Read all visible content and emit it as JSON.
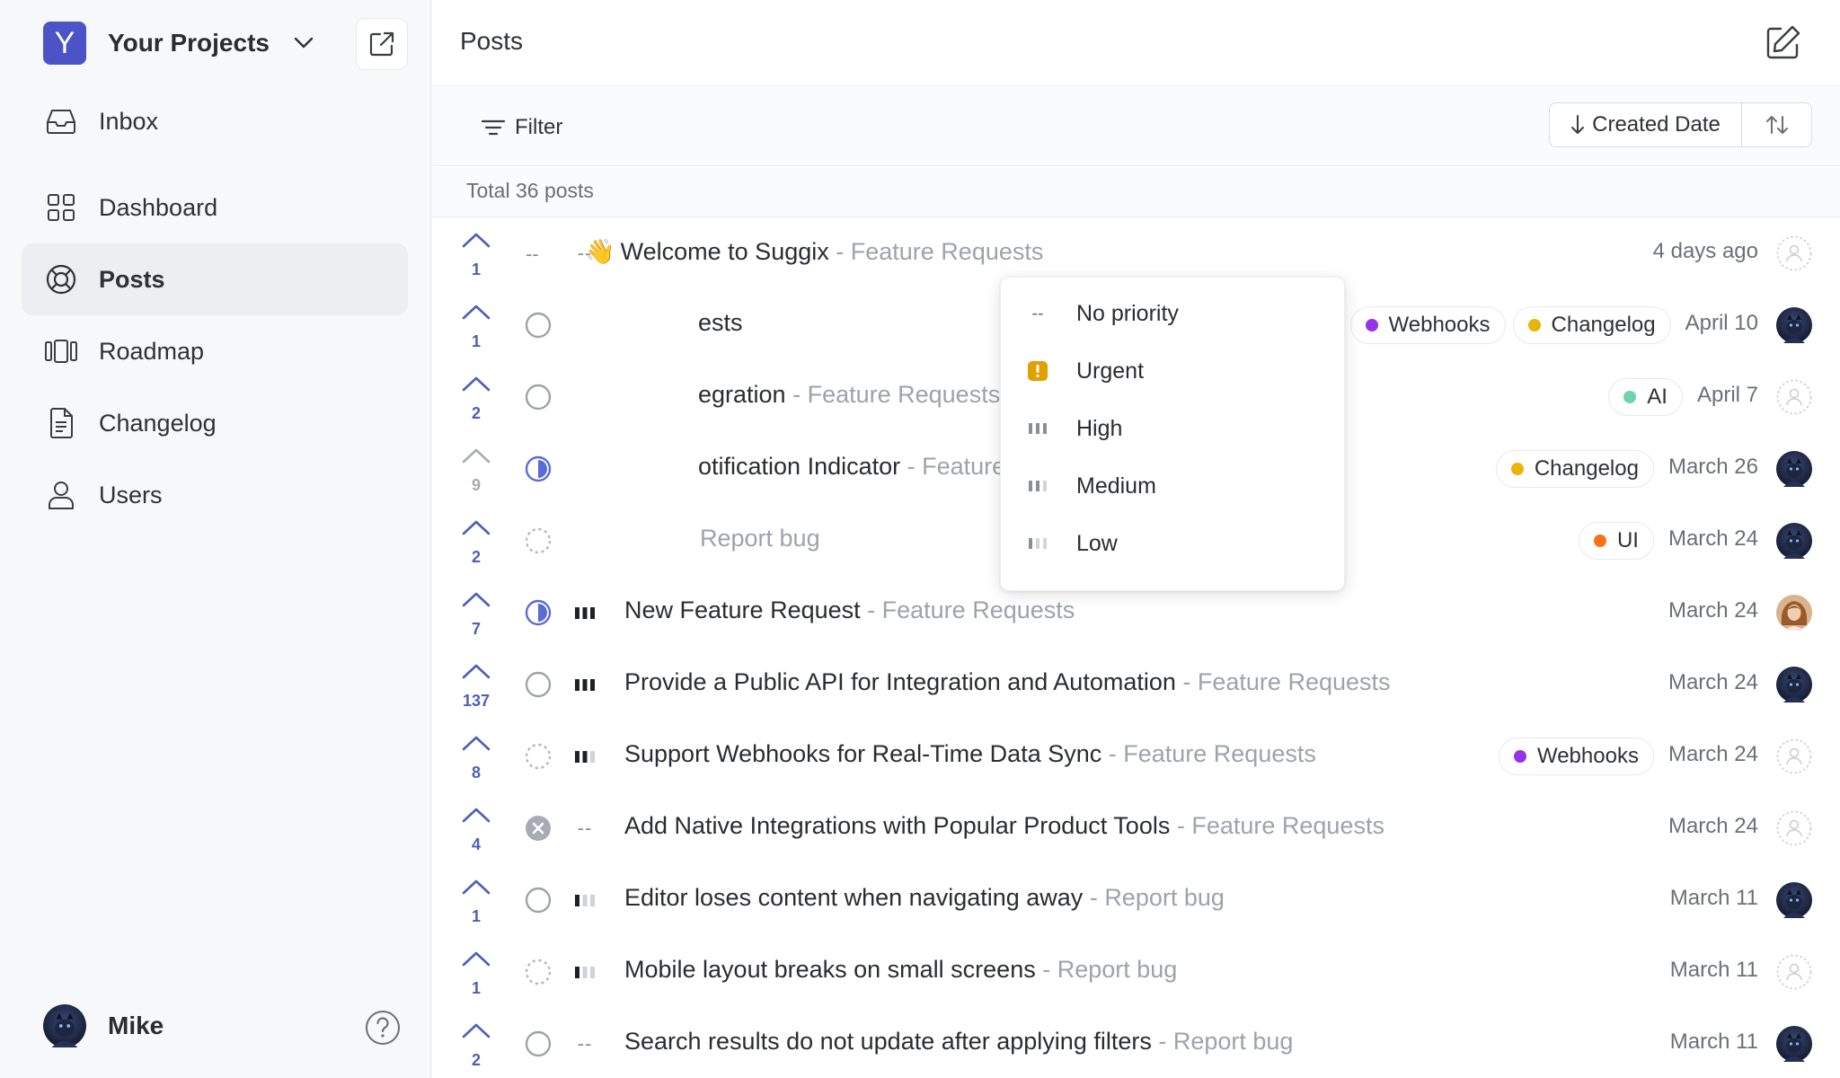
{
  "project": {
    "logo_letter": "Y",
    "name": "Your Projects"
  },
  "nav": [
    {
      "label": "Inbox",
      "icon": "inbox-icon"
    },
    {
      "label": "Dashboard",
      "icon": "grid-icon"
    },
    {
      "label": "Posts",
      "icon": "lifebuoy-icon",
      "active": true
    },
    {
      "label": "Roadmap",
      "icon": "roadmap-icon"
    },
    {
      "label": "Changelog",
      "icon": "document-icon"
    },
    {
      "label": "Users",
      "icon": "user-icon"
    }
  ],
  "user": {
    "name": "Mike"
  },
  "header": {
    "title": "Posts"
  },
  "toolbar": {
    "filter_label": "Filter",
    "sort_label": "Created Date"
  },
  "summary": {
    "total_label": "Total 36 posts"
  },
  "rows": [
    {
      "votes": "1",
      "status": "none",
      "priority": "none",
      "emoji": "👋",
      "title": "Welcome to Suggix",
      "board": "Feature Requests",
      "tags": [],
      "date": "4 days ago",
      "assignee": "empty"
    },
    {
      "votes": "1",
      "status": "open",
      "priority": "hidden",
      "title": "ests",
      "board": "",
      "tags": [
        {
          "label": "Webhooks",
          "color": "#9333ea"
        },
        {
          "label": "Changelog",
          "color": "#eab308"
        }
      ],
      "date": "April 10",
      "assignee": "dark"
    },
    {
      "votes": "2",
      "status": "open",
      "priority": "hidden",
      "title": "egration",
      "board": "Feature Requests",
      "tags": [
        {
          "label": "AI",
          "color": "#6ed3a8"
        }
      ],
      "date": "April 7",
      "assignee": "empty"
    },
    {
      "votes": "9",
      "status": "progress",
      "priority": "hidden",
      "dim": true,
      "title": "otification Indicator",
      "board": "Feature Requests",
      "tags": [
        {
          "label": "Changelog",
          "color": "#eab308"
        }
      ],
      "date": "March 26",
      "assignee": "dark"
    },
    {
      "votes": "2",
      "status": "backlog",
      "priority": "hidden",
      "title": "",
      "board": "Report bug",
      "tags": [
        {
          "label": "UI",
          "color": "#f97316"
        }
      ],
      "date": "March 24",
      "assignee": "dark"
    },
    {
      "votes": "7",
      "status": "progress",
      "priority": "high",
      "title": "New Feature Request",
      "board": "Feature Requests",
      "tags": [],
      "date": "March 24",
      "assignee": "woman"
    },
    {
      "votes": "137",
      "status": "open",
      "priority": "high",
      "title": "Provide a Public API for Integration and Automation",
      "board": "Feature Requests",
      "tags": [],
      "date": "March 24",
      "assignee": "dark"
    },
    {
      "votes": "8",
      "status": "backlog",
      "priority": "medium",
      "title": "Support Webhooks for Real-Time Data Sync",
      "board": "Feature Requests",
      "tags": [
        {
          "label": "Webhooks",
          "color": "#9333ea"
        }
      ],
      "date": "March 24",
      "assignee": "empty"
    },
    {
      "votes": "4",
      "status": "cancelled",
      "priority": "none",
      "title": "Add Native Integrations with Popular Product Tools",
      "board": "Feature Requests",
      "tags": [],
      "date": "March 24",
      "assignee": "empty"
    },
    {
      "votes": "1",
      "status": "open",
      "priority": "low",
      "title": "Editor loses content when navigating away",
      "board": "Report bug",
      "tags": [],
      "date": "March 11",
      "assignee": "dark"
    },
    {
      "votes": "1",
      "status": "backlog",
      "priority": "low",
      "title": "Mobile layout breaks on small screens",
      "board": "Report bug",
      "tags": [],
      "date": "March 11",
      "assignee": "empty"
    },
    {
      "votes": "2",
      "status": "open",
      "priority": "none",
      "title": "Search results do not update after applying filters",
      "board": "Report bug",
      "tags": [],
      "date": "March 11",
      "assignee": "dark"
    }
  ],
  "priority_menu": [
    {
      "label": "No priority",
      "key": "none"
    },
    {
      "label": "Urgent",
      "key": "urgent"
    },
    {
      "label": "High",
      "key": "high"
    },
    {
      "label": "Medium",
      "key": "medium"
    },
    {
      "label": "Low",
      "key": "low"
    }
  ],
  "colors": {
    "accent": "#4c53c7",
    "status_progress": "#5b6bd4",
    "urgent": "#e0a100",
    "vote": "#4c5fb8"
  }
}
